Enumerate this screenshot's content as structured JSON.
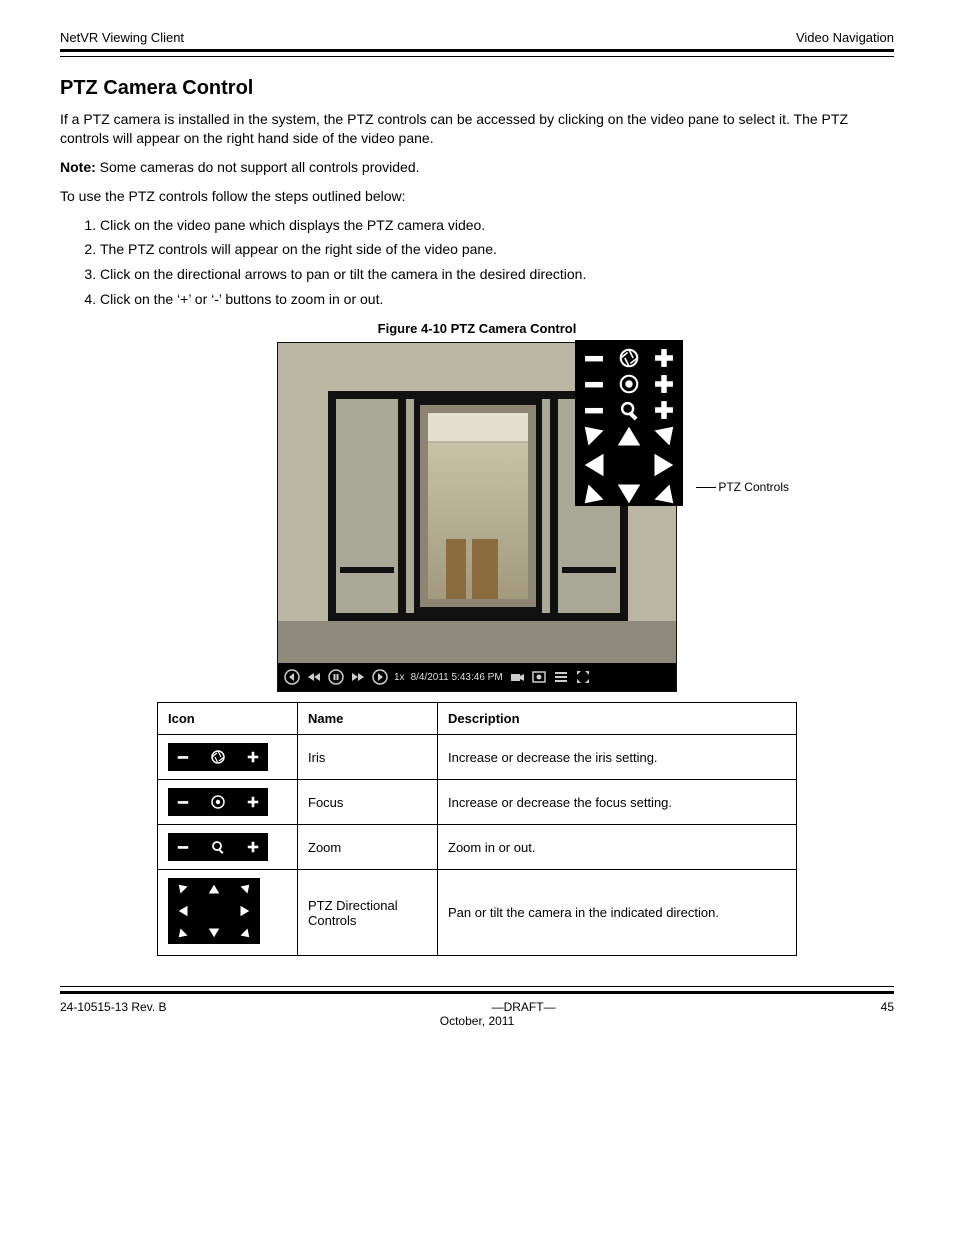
{
  "header": {
    "left": "NetVR Viewing Client",
    "right": "Video Navigation"
  },
  "section_title": "PTZ Camera Control",
  "intro": "If a PTZ camera is installed in the system, the PTZ controls can be accessed by clicking on the video pane to select it. The PTZ controls will appear on the right hand side of the video pane.",
  "note_label": "Note:",
  "note_body": " Some cameras do not support all controls provided.",
  "steps_lead": "To use the PTZ controls follow the steps outlined below:",
  "steps": [
    "Click on the video pane which displays the PTZ camera video.",
    "The PTZ controls will appear on the right side of the video pane.",
    "Click on the directional arrows to pan or tilt the camera in the desired direction.",
    "Click on the ‘+’ or ‘-’ buttons to zoom in or out."
  ],
  "figure_caption": "Figure 4-10 PTZ Camera Control",
  "callout_label": "PTZ Controls",
  "playback": {
    "speed": "1x",
    "timestamp": "8/4/2011 5:43:46 PM"
  },
  "table": {
    "headers": {
      "icon": "Icon",
      "name": "Name",
      "desc": "Description"
    },
    "rows": [
      {
        "name": "Iris",
        "desc": "Increase or decrease the iris setting."
      },
      {
        "name": "Focus",
        "desc": "Increase or decrease the focus setting."
      },
      {
        "name": "Zoom",
        "desc": "Zoom in or out."
      },
      {
        "name": "PTZ Directional Controls",
        "desc": "Pan or tilt the camera in the indicated direction."
      }
    ]
  },
  "footer": {
    "left": "24-10515-13 Rev. B",
    "center": "—DRAFT—",
    "right": "45",
    "date": "October, 2011"
  }
}
